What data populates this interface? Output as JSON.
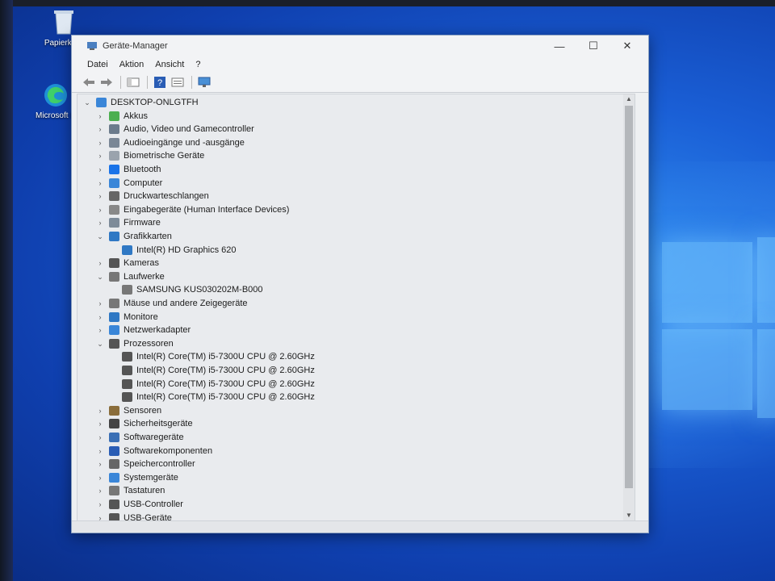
{
  "desktop": {
    "icons": [
      {
        "label": "Papierkorb",
        "icon": "recycle-bin-icon"
      },
      {
        "label": "Microsoft E",
        "icon": "edge-icon"
      }
    ]
  },
  "window": {
    "title": "Geräte-Manager",
    "controls": {
      "minimize": "—",
      "maximize": "☐",
      "close": "✕"
    },
    "menu": [
      "Datei",
      "Aktion",
      "Ansicht",
      "?"
    ]
  },
  "tree": {
    "root": "DESKTOP-ONLGTFH",
    "categories": [
      {
        "label": "Akkus",
        "icon": "battery-icon",
        "expanded": false
      },
      {
        "label": "Audio, Video und Gamecontroller",
        "icon": "speaker-icon",
        "expanded": false
      },
      {
        "label": "Audioeingänge und -ausgänge",
        "icon": "audio-io-icon",
        "expanded": false
      },
      {
        "label": "Biometrische Geräte",
        "icon": "fingerprint-icon",
        "expanded": false
      },
      {
        "label": "Bluetooth",
        "icon": "bluetooth-icon",
        "expanded": false
      },
      {
        "label": "Computer",
        "icon": "computer-icon",
        "expanded": false
      },
      {
        "label": "Druckwarteschlangen",
        "icon": "printer-icon",
        "expanded": false
      },
      {
        "label": "Eingabegeräte (Human Interface Devices)",
        "icon": "hid-icon",
        "expanded": false
      },
      {
        "label": "Firmware",
        "icon": "firmware-icon",
        "expanded": false
      },
      {
        "label": "Grafikkarten",
        "icon": "display-adapter-icon",
        "expanded": true,
        "children": [
          "Intel(R) HD Graphics 620"
        ]
      },
      {
        "label": "Kameras",
        "icon": "camera-icon",
        "expanded": false
      },
      {
        "label": "Laufwerke",
        "icon": "drive-icon",
        "expanded": true,
        "children": [
          "SAMSUNG KUS030202M-B000"
        ]
      },
      {
        "label": "Mäuse und andere Zeigegeräte",
        "icon": "mouse-icon",
        "expanded": false
      },
      {
        "label": "Monitore",
        "icon": "monitor-icon",
        "expanded": false
      },
      {
        "label": "Netzwerkadapter",
        "icon": "network-adapter-icon",
        "expanded": false
      },
      {
        "label": "Prozessoren",
        "icon": "processor-icon",
        "expanded": true,
        "children": [
          "Intel(R) Core(TM) i5-7300U CPU @ 2.60GHz",
          "Intel(R) Core(TM) i5-7300U CPU @ 2.60GHz",
          "Intel(R) Core(TM) i5-7300U CPU @ 2.60GHz",
          "Intel(R) Core(TM) i5-7300U CPU @ 2.60GHz"
        ]
      },
      {
        "label": "Sensoren",
        "icon": "sensor-icon",
        "expanded": false
      },
      {
        "label": "Sicherheitsgeräte",
        "icon": "security-device-icon",
        "expanded": false
      },
      {
        "label": "Softwaregeräte",
        "icon": "software-device-icon",
        "expanded": false
      },
      {
        "label": "Softwarekomponenten",
        "icon": "software-component-icon",
        "expanded": false
      },
      {
        "label": "Speichercontroller",
        "icon": "storage-controller-icon",
        "expanded": false
      },
      {
        "label": "Systemgeräte",
        "icon": "system-device-icon",
        "expanded": false
      },
      {
        "label": "Tastaturen",
        "icon": "keyboard-icon",
        "expanded": false
      },
      {
        "label": "USB-Controller",
        "icon": "usb-icon",
        "expanded": false
      },
      {
        "label": "USB-Geräte",
        "icon": "usb-device-icon",
        "expanded": false
      }
    ]
  }
}
